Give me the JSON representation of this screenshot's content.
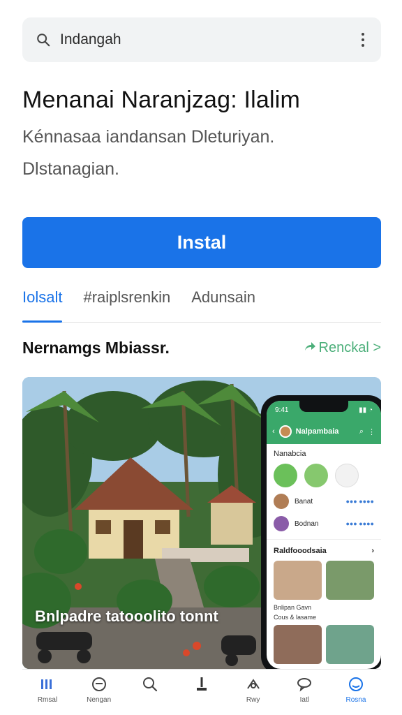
{
  "search": {
    "text": "Indangah",
    "icon": "search-icon",
    "more_icon": "more-vert-icon"
  },
  "app": {
    "title": "Menanai Naranjzag: Ilalim",
    "description_line1": "Kénnasaa iandansan Dleturiyan.",
    "description_line2": "Dlstanagian."
  },
  "install": {
    "label": "Instal"
  },
  "tabs": [
    {
      "label": "Iolsalt",
      "active": true
    },
    {
      "label": "#raiplsrenkin",
      "active": false
    },
    {
      "label": "Adunsain",
      "active": false
    }
  ],
  "section": {
    "title": "Nernamgs Mbiassr.",
    "link": "Renckal >"
  },
  "hero": {
    "caption": "Bnlpadre tatooolito tonnt"
  },
  "phone": {
    "time": "9:41",
    "title": "Nalpambaia",
    "label": "Nanabcia",
    "rows": [
      {
        "name": "Banat",
        "value": "●●● ●●●●"
      },
      {
        "name": "Bodnan",
        "value": "●●● ●●●●"
      }
    ],
    "section": "Raldfooodsaia",
    "caption1": "Bnlipan Gavn",
    "caption2": "Cous & lasame"
  },
  "bottom_nav": [
    {
      "label": "Rmsal",
      "icon": "library-icon"
    },
    {
      "label": "Nengan",
      "icon": "gamepad-icon"
    },
    {
      "label": "",
      "icon": "search-icon"
    },
    {
      "label": "",
      "icon": "joystick-icon"
    },
    {
      "label": "Rwy",
      "icon": "apps-icon"
    },
    {
      "label": "Iatl",
      "icon": "chat-icon"
    },
    {
      "label": "Rosna",
      "icon": "account-icon",
      "active": true
    }
  ],
  "colors": {
    "accent": "#1a73e8",
    "green": "#3aa86a",
    "link_green": "#4caf7a"
  }
}
